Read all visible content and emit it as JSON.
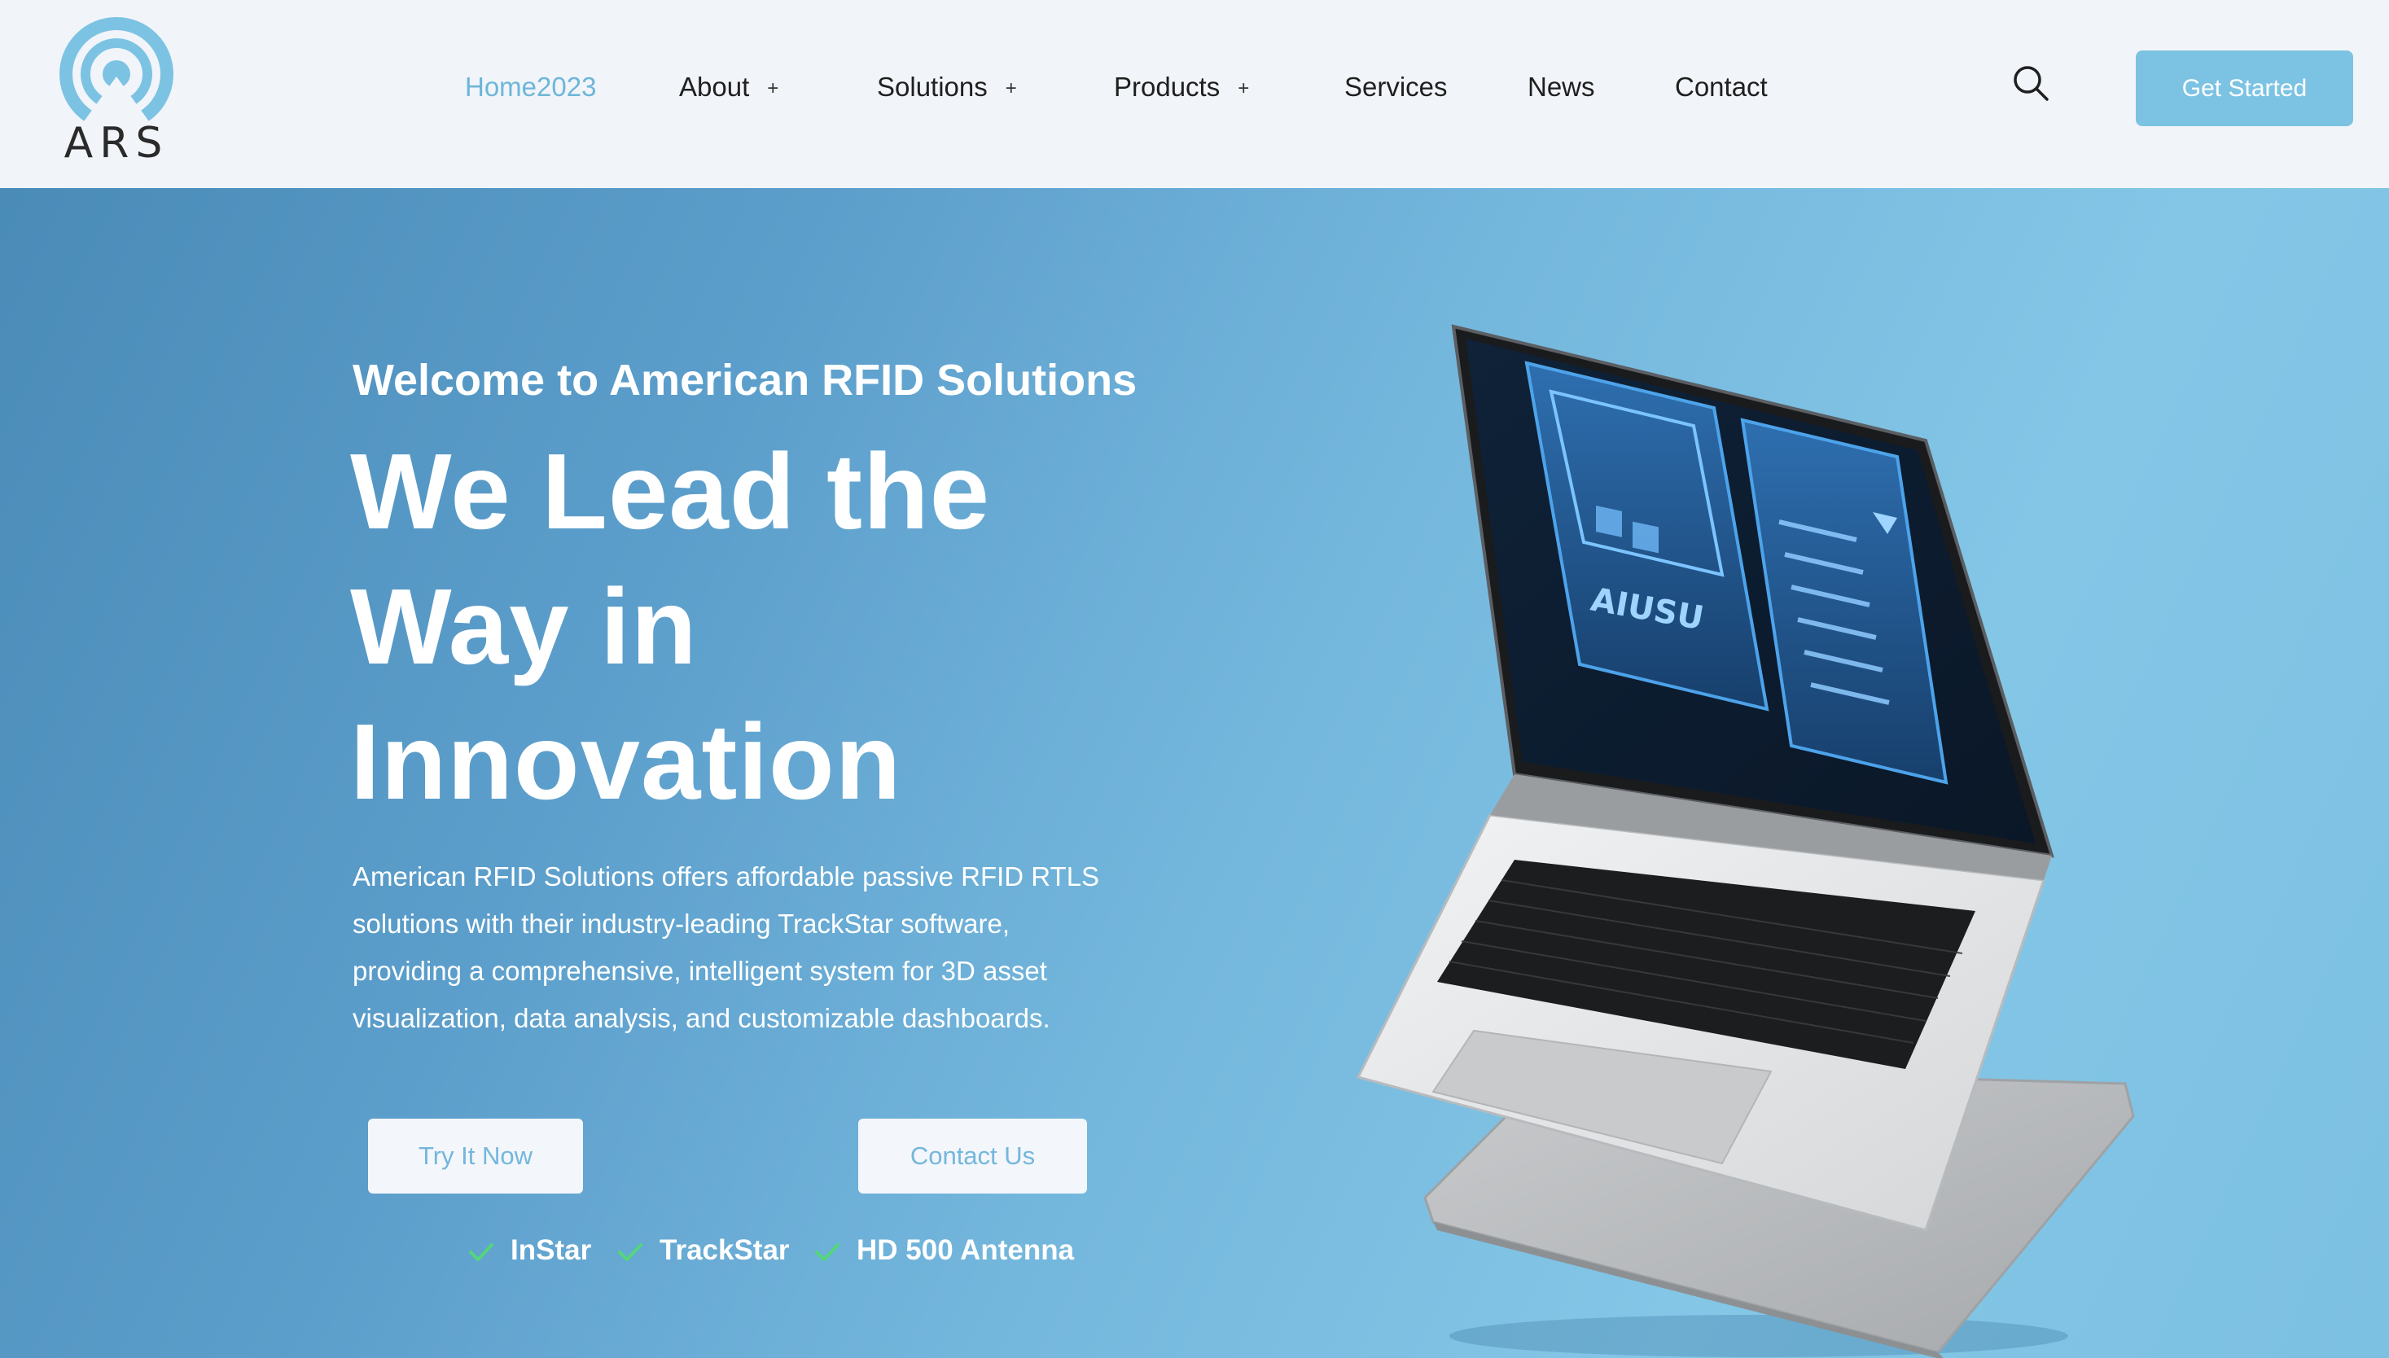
{
  "brand": {
    "name": "ARS",
    "accent": "#7cc3e3"
  },
  "nav": {
    "items": [
      {
        "label": "Home2023",
        "active": true
      },
      {
        "label": "About",
        "has_submenu": true
      },
      {
        "label": "Solutions",
        "has_submenu": true
      },
      {
        "label": "Products",
        "has_submenu": true
      },
      {
        "label": "Services"
      },
      {
        "label": "News"
      },
      {
        "label": "Contact"
      }
    ],
    "submenu_glyph": "+",
    "search_icon": "search-icon",
    "cta_label": "Get Started"
  },
  "hero": {
    "eyebrow": "Welcome to American RFID Solutions",
    "headline_lines": [
      "We Lead the",
      "Way in",
      "Innovation"
    ],
    "description_lines": [
      "American RFID Solutions offers affordable passive RFID RTLS",
      "solutions with their industry-leading TrackStar software,",
      "providing a comprehensive, intelligent system for 3D asset",
      "visualization, data analysis, and customizable dashboards."
    ],
    "primary_button": "Try It Now",
    "secondary_button": "Contact Us",
    "features": [
      "InStar",
      "TrackStar",
      "HD 500 Antenna"
    ],
    "check_color": "#54d67a",
    "screen_logo_text": "AIUSU"
  }
}
